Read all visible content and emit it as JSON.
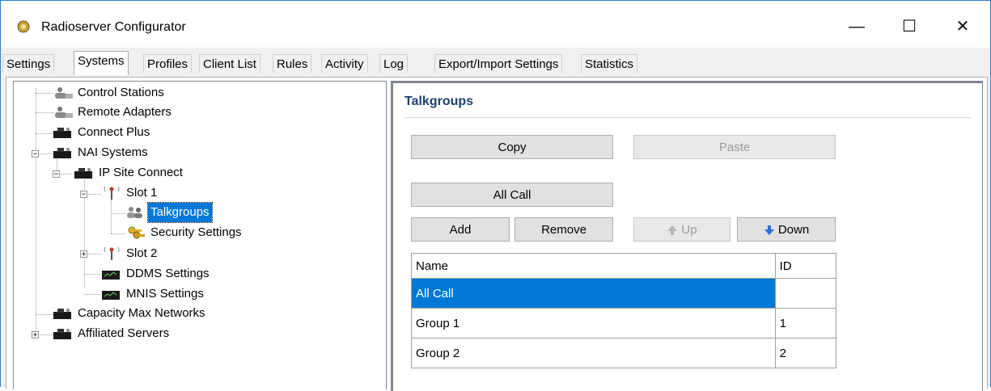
{
  "window": {
    "title": "Radioserver Configurator",
    "minimize_glyph": "—",
    "maximize_glyph": "☐",
    "close_glyph": "✕"
  },
  "tabs": [
    {
      "label": "Settings"
    },
    {
      "label": "Systems",
      "active": true
    },
    {
      "label": "Profiles"
    },
    {
      "label": "Client List"
    },
    {
      "label": "Rules"
    },
    {
      "label": "Activity"
    },
    {
      "label": "Log"
    },
    {
      "label": "Export/Import Settings"
    },
    {
      "label": "Statistics"
    }
  ],
  "tree": {
    "items": [
      {
        "label": "Control Stations",
        "icon": "control-stations-icon"
      },
      {
        "label": "Remote Adapters",
        "icon": "remote-adapters-icon"
      },
      {
        "label": "Connect Plus",
        "icon": "server-icon"
      },
      {
        "label": "NAI Systems",
        "icon": "server-icon",
        "expanded": true
      },
      {
        "label": "IP Site Connect",
        "icon": "server-icon",
        "expanded": true
      },
      {
        "label": "Slot 1",
        "icon": "antenna-icon",
        "expanded": true
      },
      {
        "label": "Talkgroups",
        "icon": "talkgroups-icon",
        "selected": true
      },
      {
        "label": "Security Settings",
        "icon": "security-keys-icon"
      },
      {
        "label": "Slot 2",
        "icon": "antenna-icon",
        "expanded": false
      },
      {
        "label": "DDMS Settings",
        "icon": "monitor-icon"
      },
      {
        "label": "MNIS Settings",
        "icon": "monitor-icon"
      },
      {
        "label": "Capacity Max Networks",
        "icon": "server-icon"
      },
      {
        "label": "Affiliated Servers",
        "icon": "server-icon",
        "expanded": false
      }
    ]
  },
  "panel": {
    "title": "Talkgroups",
    "buttons": {
      "copy": "Copy",
      "paste": "Paste",
      "all_call": "All Call",
      "add": "Add",
      "remove": "Remove",
      "up": "Up",
      "down": "Down"
    },
    "table": {
      "columns": [
        "Name",
        "ID"
      ],
      "rows": [
        {
          "name": "All Call",
          "id": "",
          "selected": true
        },
        {
          "name": "Group 1",
          "id": "1"
        },
        {
          "name": "Group 2",
          "id": "2"
        }
      ]
    }
  },
  "colors": {
    "selection": "#0078d7",
    "title_accent": "#1e3f6e",
    "window_border": "#2b7bd4"
  }
}
